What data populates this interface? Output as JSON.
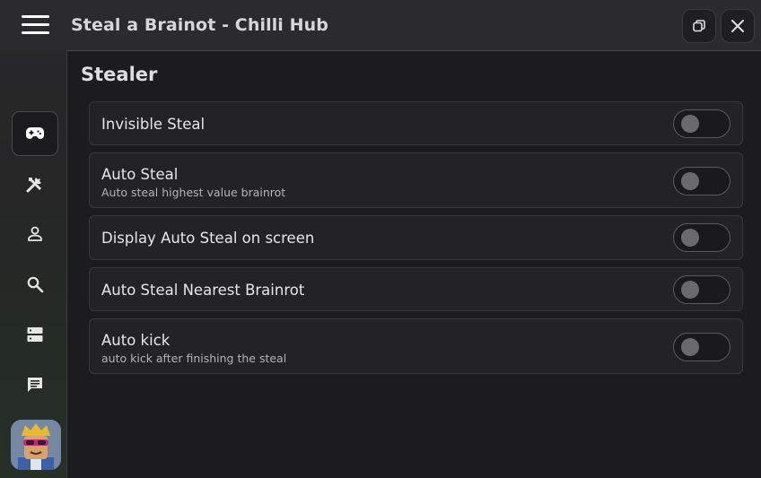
{
  "window": {
    "title": "Steal a Brainot - Chilli Hub"
  },
  "sidebar": {
    "items": [
      {
        "icon": "gamepad-icon",
        "active": true
      },
      {
        "icon": "tools-icon",
        "active": false
      },
      {
        "icon": "person-icon",
        "active": false
      },
      {
        "icon": "search-icon",
        "active": false
      },
      {
        "icon": "server-icon",
        "active": false
      },
      {
        "icon": "chat-icon",
        "active": false
      }
    ],
    "avatar": "user-avatar"
  },
  "main": {
    "section_title": "Stealer",
    "options": [
      {
        "title": "Invisible Steal",
        "description": "",
        "enabled": false
      },
      {
        "title": "Auto Steal",
        "description": "Auto steal highest value brainrot",
        "enabled": false
      },
      {
        "title": "Display Auto Steal on screen",
        "description": "",
        "enabled": false
      },
      {
        "title": "Auto Steal Nearest Brainrot",
        "description": "",
        "enabled": false
      },
      {
        "title": "Auto kick",
        "description": "auto kick after finishing the steal",
        "enabled": false
      }
    ]
  },
  "colors": {
    "background": "#1c1c1e",
    "row_background": "#232325",
    "toggle_knob_off": "#6a6a6c",
    "text_primary": "#e6e6e8"
  }
}
